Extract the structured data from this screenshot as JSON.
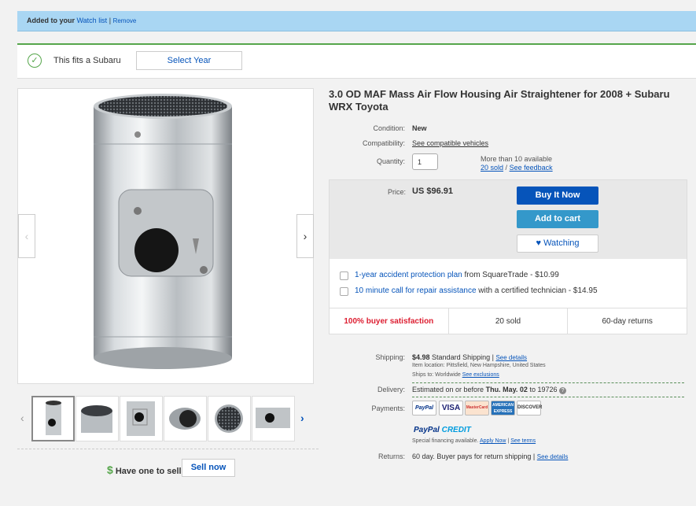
{
  "watch_banner": {
    "prefix": "Added to your",
    "watch_link": "Watch list",
    "separator": "|",
    "remove": "Remove"
  },
  "fitment": {
    "text": "This fits a Subaru",
    "select_label": "Select Year"
  },
  "title": "3.0 OD MAF Mass Air Flow Housing Air Straightener for 2008 + Subaru WRX Toyota",
  "condition": {
    "label": "Condition:",
    "value": "New"
  },
  "compatibility": {
    "label": "Compatibility:",
    "value": "See compatible vehicles"
  },
  "quantity": {
    "label": "Quantity:",
    "value": "1",
    "available": "More than 10 available",
    "sold": "20 sold",
    "sep": "/",
    "feedback": "See feedback"
  },
  "buy": {
    "price_label": "Price:",
    "price": "US $96.91",
    "buy_now": "Buy It Now",
    "add_to_cart": "Add to cart",
    "watching": "Watching",
    "addon1_link": "1-year accident protection plan",
    "addon1_rest": " from SquareTrade - $10.99",
    "addon2_link": "10 minute call for repair assistance",
    "addon2_rest": " with a certified technician - $14.95",
    "stat1": "100% buyer satisfaction",
    "stat2": "20 sold",
    "stat3": "60-day returns"
  },
  "shipping": {
    "label": "Shipping:",
    "cost": "$4.98",
    "method": "Standard Shipping |",
    "details": "See details",
    "location": "Item location:  Pittsfield, New Hampshire, United States",
    "ships_to_prefix": "Ships to:  Worldwide",
    "exclusions": "See exclusions"
  },
  "delivery": {
    "label": "Delivery:",
    "prefix": "Estimated on or before",
    "date": "Thu. May. 02",
    "suffix": "to 19726"
  },
  "payments": {
    "label": "Payments:",
    "cards": [
      "PayPal",
      "VISA",
      "MasterCard",
      "AMERICAN EXPRESS",
      "DISCOVER"
    ],
    "credit_a": "PayPal",
    "credit_b": "CREDIT",
    "financing": "Special financing available.",
    "apply": "Apply Now",
    "sep": "|",
    "terms": "See terms"
  },
  "returns": {
    "label": "Returns:",
    "value": "60 day. Buyer pays for return shipping |",
    "details": "See details"
  },
  "sell": {
    "question": "Have one to sell?",
    "dollar": "$",
    "button": "Sell now"
  },
  "colors": {
    "accent": "#0654ba",
    "buy_now": "#0654ba",
    "cart": "#3498ca",
    "fit_green": "#56a64b",
    "banner": "#a9d6f3",
    "satisfaction": "#dd1e31"
  }
}
